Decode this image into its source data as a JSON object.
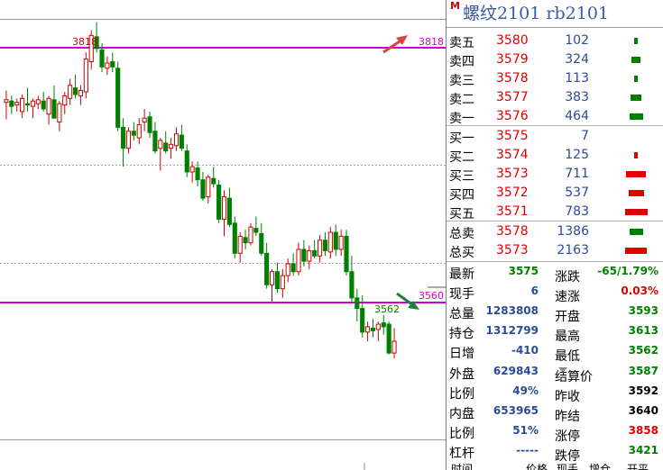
{
  "chart": {
    "high_label": "3818",
    "low_label": "3562",
    "level_top": "3818",
    "level_bottom": "3560",
    "colors": {
      "up": "#d00000",
      "down": "#008000",
      "level": "#d000d0",
      "arrow_up": "#e04040",
      "arrow_down": "#208040"
    },
    "candles": [
      {
        "o": 3757,
        "h": 3766,
        "l": 3744,
        "c": 3759
      },
      {
        "o": 3758,
        "h": 3762,
        "l": 3748,
        "c": 3754
      },
      {
        "o": 3755,
        "h": 3760,
        "l": 3750,
        "c": 3757
      },
      {
        "o": 3750,
        "h": 3763,
        "l": 3745,
        "c": 3760
      },
      {
        "o": 3756,
        "h": 3768,
        "l": 3750,
        "c": 3755
      },
      {
        "o": 3754,
        "h": 3760,
        "l": 3745,
        "c": 3758
      },
      {
        "o": 3756,
        "h": 3762,
        "l": 3752,
        "c": 3759
      },
      {
        "o": 3758,
        "h": 3765,
        "l": 3750,
        "c": 3752
      },
      {
        "o": 3748,
        "h": 3762,
        "l": 3740,
        "c": 3760
      },
      {
        "o": 3759,
        "h": 3770,
        "l": 3745,
        "c": 3745
      },
      {
        "o": 3742,
        "h": 3758,
        "l": 3735,
        "c": 3756
      },
      {
        "o": 3755,
        "h": 3765,
        "l": 3748,
        "c": 3762
      },
      {
        "o": 3760,
        "h": 3775,
        "l": 3755,
        "c": 3770
      },
      {
        "o": 3768,
        "h": 3778,
        "l": 3760,
        "c": 3763
      },
      {
        "o": 3762,
        "h": 3770,
        "l": 3755,
        "c": 3766
      },
      {
        "o": 3765,
        "h": 3795,
        "l": 3760,
        "c": 3790
      },
      {
        "o": 3788,
        "h": 3812,
        "l": 3782,
        "c": 3808
      },
      {
        "o": 3807,
        "h": 3818,
        "l": 3795,
        "c": 3798
      },
      {
        "o": 3797,
        "h": 3802,
        "l": 3780,
        "c": 3784
      },
      {
        "o": 3783,
        "h": 3792,
        "l": 3778,
        "c": 3787
      },
      {
        "o": 3788,
        "h": 3795,
        "l": 3780,
        "c": 3784
      },
      {
        "o": 3783,
        "h": 3788,
        "l": 3735,
        "c": 3738
      },
      {
        "o": 3738,
        "h": 3745,
        "l": 3708,
        "c": 3722
      },
      {
        "o": 3722,
        "h": 3738,
        "l": 3718,
        "c": 3735
      },
      {
        "o": 3735,
        "h": 3742,
        "l": 3728,
        "c": 3732
      },
      {
        "o": 3730,
        "h": 3745,
        "l": 3725,
        "c": 3740
      },
      {
        "o": 3742,
        "h": 3752,
        "l": 3735,
        "c": 3745
      },
      {
        "o": 3746,
        "h": 3750,
        "l": 3730,
        "c": 3734
      },
      {
        "o": 3735,
        "h": 3742,
        "l": 3718,
        "c": 3720
      },
      {
        "o": 3722,
        "h": 3730,
        "l": 3705,
        "c": 3728
      },
      {
        "o": 3726,
        "h": 3735,
        "l": 3718,
        "c": 3720
      },
      {
        "o": 3722,
        "h": 3730,
        "l": 3714,
        "c": 3725
      },
      {
        "o": 3724,
        "h": 3738,
        "l": 3720,
        "c": 3733
      },
      {
        "o": 3732,
        "h": 3740,
        "l": 3720,
        "c": 3722
      },
      {
        "o": 3720,
        "h": 3725,
        "l": 3700,
        "c": 3704
      },
      {
        "o": 3704,
        "h": 3712,
        "l": 3696,
        "c": 3708
      },
      {
        "o": 3707,
        "h": 3712,
        "l": 3693,
        "c": 3698
      },
      {
        "o": 3698,
        "h": 3704,
        "l": 3682,
        "c": 3684
      },
      {
        "o": 3685,
        "h": 3702,
        "l": 3680,
        "c": 3700
      },
      {
        "o": 3699,
        "h": 3708,
        "l": 3692,
        "c": 3695
      },
      {
        "o": 3694,
        "h": 3698,
        "l": 3665,
        "c": 3668
      },
      {
        "o": 3668,
        "h": 3690,
        "l": 3655,
        "c": 3685
      },
      {
        "o": 3684,
        "h": 3692,
        "l": 3662,
        "c": 3664
      },
      {
        "o": 3665,
        "h": 3670,
        "l": 3638,
        "c": 3642
      },
      {
        "o": 3642,
        "h": 3658,
        "l": 3635,
        "c": 3655
      },
      {
        "o": 3654,
        "h": 3660,
        "l": 3645,
        "c": 3650
      },
      {
        "o": 3650,
        "h": 3665,
        "l": 3648,
        "c": 3662
      },
      {
        "o": 3661,
        "h": 3670,
        "l": 3655,
        "c": 3658
      },
      {
        "o": 3657,
        "h": 3665,
        "l": 3640,
        "c": 3642
      },
      {
        "o": 3642,
        "h": 3650,
        "l": 3615,
        "c": 3618
      },
      {
        "o": 3618,
        "h": 3630,
        "l": 3605,
        "c": 3628
      },
      {
        "o": 3628,
        "h": 3635,
        "l": 3612,
        "c": 3615
      },
      {
        "o": 3615,
        "h": 3630,
        "l": 3608,
        "c": 3625
      },
      {
        "o": 3625,
        "h": 3638,
        "l": 3620,
        "c": 3634
      },
      {
        "o": 3634,
        "h": 3642,
        "l": 3625,
        "c": 3628
      },
      {
        "o": 3628,
        "h": 3650,
        "l": 3625,
        "c": 3645
      },
      {
        "o": 3645,
        "h": 3652,
        "l": 3632,
        "c": 3636
      },
      {
        "o": 3636,
        "h": 3648,
        "l": 3630,
        "c": 3644
      },
      {
        "o": 3644,
        "h": 3652,
        "l": 3638,
        "c": 3640
      },
      {
        "o": 3640,
        "h": 3656,
        "l": 3635,
        "c": 3652
      },
      {
        "o": 3652,
        "h": 3658,
        "l": 3640,
        "c": 3644
      },
      {
        "o": 3643,
        "h": 3662,
        "l": 3638,
        "c": 3658
      },
      {
        "o": 3658,
        "h": 3664,
        "l": 3640,
        "c": 3645
      },
      {
        "o": 3645,
        "h": 3660,
        "l": 3640,
        "c": 3655
      },
      {
        "o": 3655,
        "h": 3660,
        "l": 3625,
        "c": 3628
      },
      {
        "o": 3628,
        "h": 3640,
        "l": 3605,
        "c": 3608
      },
      {
        "o": 3608,
        "h": 3615,
        "l": 3590,
        "c": 3600
      },
      {
        "o": 3600,
        "h": 3610,
        "l": 3578,
        "c": 3582
      },
      {
        "o": 3582,
        "h": 3590,
        "l": 3575,
        "c": 3586
      },
      {
        "o": 3585,
        "h": 3592,
        "l": 3578,
        "c": 3583
      },
      {
        "o": 3584,
        "h": 3590,
        "l": 3575,
        "c": 3588
      },
      {
        "o": 3589,
        "h": 3595,
        "l": 3580,
        "c": 3586
      },
      {
        "o": 3588,
        "h": 3590,
        "l": 3565,
        "c": 3566
      },
      {
        "o": 3566,
        "h": 3585,
        "l": 3562,
        "c": 3575
      }
    ],
    "price_min": 3540,
    "price_max": 3835
  },
  "panel": {
    "title_mark": "M",
    "title": "螺纹2101  rb2101",
    "sells": [
      {
        "label": "卖五",
        "price": "3580",
        "vol": "102",
        "bar": 4,
        "color": "#008000"
      },
      {
        "label": "卖四",
        "price": "3579",
        "vol": "324",
        "bar": 10,
        "color": "#008000"
      },
      {
        "label": "卖三",
        "price": "3578",
        "vol": "113",
        "bar": 4,
        "color": "#008000"
      },
      {
        "label": "卖二",
        "price": "3577",
        "vol": "383",
        "bar": 12,
        "color": "#008000"
      },
      {
        "label": "卖一",
        "price": "3576",
        "vol": "464",
        "bar": 15,
        "color": "#008000"
      }
    ],
    "buys": [
      {
        "label": "买一",
        "price": "3575",
        "vol": "7",
        "bar": 0,
        "color": "#e00000"
      },
      {
        "label": "买二",
        "price": "3574",
        "vol": "125",
        "bar": 4,
        "color": "#e00000"
      },
      {
        "label": "买三",
        "price": "3573",
        "vol": "711",
        "bar": 22,
        "color": "#e00000"
      },
      {
        "label": "买四",
        "price": "3572",
        "vol": "537",
        "bar": 17,
        "color": "#e00000"
      },
      {
        "label": "买五",
        "price": "3571",
        "vol": "783",
        "bar": 25,
        "color": "#e00000"
      }
    ],
    "totals": [
      {
        "label": "总卖",
        "price": "3578",
        "vol": "1386",
        "bar": 15,
        "color": "#008000"
      },
      {
        "label": "总买",
        "price": "3573",
        "vol": "2163",
        "bar": 24,
        "color": "#e00000"
      }
    ],
    "stats": [
      {
        "l1": "最新",
        "v1": "3575",
        "c1": "#008000",
        "l2": "涨跌",
        "v2": "-65/1.79%",
        "c2": "#008000"
      },
      {
        "l1": "现手",
        "v1": "6",
        "c1": "#2a4a9a",
        "l2": "速涨",
        "v2": "0.03%",
        "c2": "#e00000"
      },
      {
        "l1": "总量",
        "v1": "1283808",
        "c1": "#2a4a9a",
        "l2": "开盘",
        "v2": "3593",
        "c2": "#008000"
      },
      {
        "l1": "持仓",
        "v1": "1312799",
        "c1": "#2a4a9a",
        "l2": "最高",
        "v2": "3613",
        "c2": "#008000"
      },
      {
        "l1": "日增",
        "v1": "-410",
        "c1": "#2a4a9a",
        "l2": "最低",
        "v2": "3562",
        "c2": "#008000"
      },
      {
        "l1": "外盘",
        "v1": "629843",
        "c1": "#2a4a9a",
        "l2": "结算价",
        "v2": "3587",
        "c2": "#008000"
      },
      {
        "l1": "比例",
        "v1": "49%",
        "c1": "#2a4a9a",
        "l2": "昨收",
        "v2": "3592",
        "c2": "#000000"
      },
      {
        "l1": "内盘",
        "v1": "653965",
        "c1": "#2a4a9a",
        "l2": "昨结",
        "v2": "3640",
        "c2": "#000000"
      },
      {
        "l1": "比例",
        "v1": "51%",
        "c1": "#2a4a9a",
        "l2": "涨停",
        "v2": "3858",
        "c2": "#e00000"
      },
      {
        "l1": "杠杆",
        "v1": "-----",
        "c1": "#2a4a9a",
        "l2": "跌停",
        "v2": "3421",
        "c2": "#008000"
      }
    ],
    "footer": [
      "时间",
      "价格",
      "现手",
      "增仓",
      "开平"
    ]
  }
}
